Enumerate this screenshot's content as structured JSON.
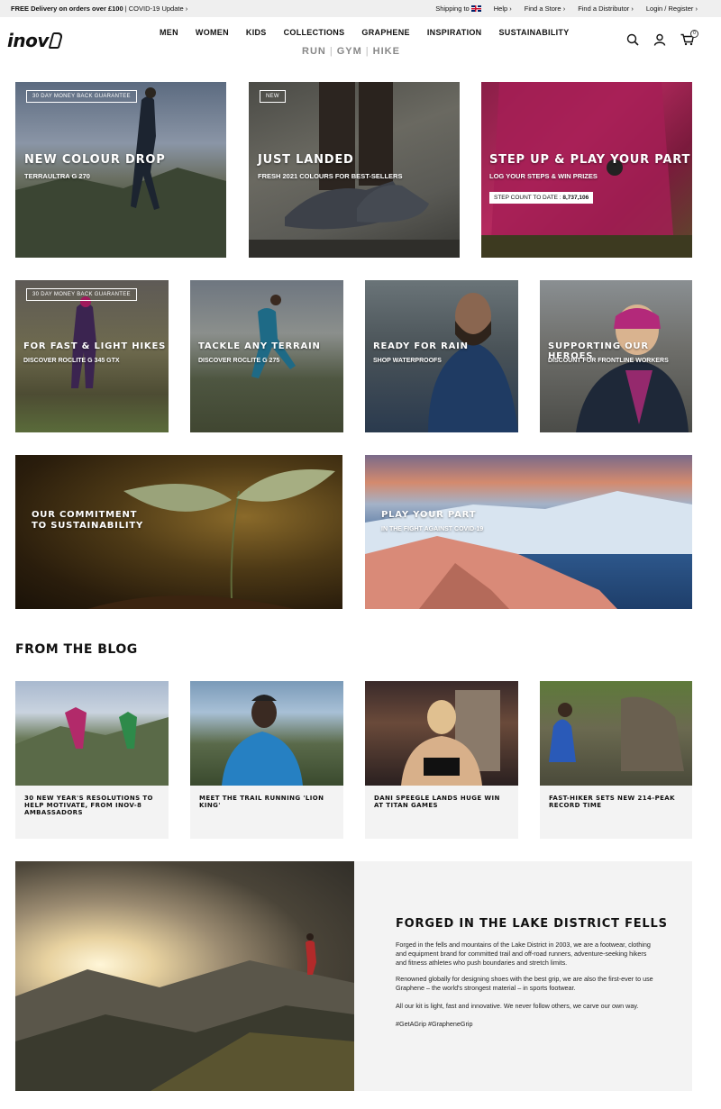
{
  "topbar": {
    "delivery": "FREE Delivery on orders over £100",
    "separator": " | ",
    "covid": "COVID-19 Update ›",
    "shipping": "Shipping to",
    "help": "Help ›",
    "store": "Find a Store ›",
    "distributor": "Find a Distributor ›",
    "login": "Login / Register ›"
  },
  "header": {
    "logo": "inov",
    "nav": [
      "MEN",
      "WOMEN",
      "KIDS",
      "COLLECTIONS",
      "GRAPHENE",
      "INSPIRATION",
      "SUSTAINABILITY"
    ],
    "subnav": [
      "RUN",
      "GYM",
      "HIKE"
    ],
    "subnav_sep": "|",
    "cart_count": "0",
    "icons": [
      "search-icon",
      "user-icon",
      "cart-icon"
    ]
  },
  "hero": [
    {
      "tag": "30 DAY MONEY BACK GUARANTEE",
      "title": "NEW COLOUR DROP",
      "sub": "TERRAULTRA G 270"
    },
    {
      "tag": "NEW",
      "title": "JUST LANDED",
      "sub": "FRESH 2021 COLOURS FOR BEST-SELLERS"
    },
    {
      "title": "STEP UP & PLAY YOUR PART",
      "sub": "LOG YOUR STEPS & WIN PRIZES",
      "counter_label": "STEP COUNT TO DATE : ",
      "counter_value": "8,737,106"
    }
  ],
  "row2": [
    {
      "tag": "30 DAY MONEY BACK GUARANTEE",
      "title": "FOR FAST & LIGHT HIKES",
      "sub": "DISCOVER ROCLITE G 345 GTX"
    },
    {
      "title": "TACKLE ANY TERRAIN",
      "sub": "DISCOVER ROCLITE G 275"
    },
    {
      "title": "READY FOR RAIN",
      "sub": "SHOP WATERPROOFS"
    },
    {
      "title": "SUPPORTING OUR HEROES",
      "sub": "DISCOUNT FOR FRONTLINE WORKERS"
    }
  ],
  "row3": [
    {
      "title1": "OUR COMMITMENT",
      "title2": "TO SUSTAINABILITY"
    },
    {
      "title": "PLAY YOUR PART",
      "sub": "IN THE FIGHT AGAINST COVID-19"
    }
  ],
  "blog": {
    "title": "FROM THE BLOG",
    "posts": [
      "30 NEW YEAR'S RESOLUTIONS TO HELP MOTIVATE, FROM INOV-8 AMBASSADORS",
      "MEET THE TRAIL RUNNING 'LION KING'",
      "DANI SPEEGLE LANDS HUGE WIN AT TITAN GAMES",
      "FAST-HIKER SETS NEW 214-PEAK RECORD TIME"
    ]
  },
  "about": {
    "title": "FORGED IN THE LAKE DISTRICT FELLS",
    "p1": "Forged in the fells and mountains of the Lake District in 2003, we are a footwear, clothing and equipment brand for committed trail and off-road runners, adventure-seeking hikers and fitness athletes who push boundaries and stretch limits.",
    "p2": "Renowned globally for designing shoes with the best grip, we are also the first-ever to use Graphene – the world's strongest material – in sports footwear.",
    "p3": "All our kit is light, fast and innovative. We never follow others, we carve our own way.",
    "p4": "#GetAGrip #GrapheneGrip"
  }
}
